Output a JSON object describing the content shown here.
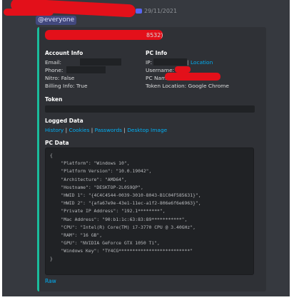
{
  "message": {
    "timestamp": "29/11/2021",
    "mention": "@everyone",
    "author_suffix": "8532)"
  },
  "embed": {
    "account_info_title": "Account Info",
    "pc_info_title": "PC Info",
    "account": {
      "email_label": "Email:",
      "phone_label": "Phone:",
      "nitro": "Nitro: False",
      "billing": "Billing Info: True"
    },
    "pc": {
      "ip_label": "IP:",
      "location_link": "Location",
      "username_label": "Username:",
      "pc_name_label": "PC Nam",
      "token_location": "Token Location: Google Chrome"
    },
    "token_title": "Token",
    "logged_data_title": "Logged Data",
    "logged_links": [
      "History",
      "Cookies",
      "Passwords",
      "Desktop Image"
    ],
    "pc_data_title": "PC Data",
    "code_lines": [
      "{",
      "    \"Platform\": \"Windows 10\",",
      "    \"Platform Version\": \"10.0.19042\",",
      "    \"Architecture\": \"AMD64\",",
      "    \"Hostname\": \"DESKTOP-2L0S9QP\",",
      "    \"HWID 1\": \"{4C4C4544-0039-3010-8043-B1C04F585631}\",",
      "    \"HWID 2\": \"{afa67e9e-43e1-11ec-a1f2-806e6f6e6963}\",",
      "    \"Private IP Address\": \"192.1********\",",
      "    \"Mac Address\": \"90:b1:1c:63:83:89***********\",",
      "    \"CPU\": \"Intel(R) Core(TM) i7-3770 CPU @ 3.40GHz\",",
      "    \"RAM\": \"16 GB\",",
      "    \"GPU\": \"NVIDIA GeForce GTX 1050 Ti\",",
      "    \"Windows Key\": \"TY4CG**************************\"",
      "}"
    ],
    "raw_link": "Raw"
  },
  "colors": {
    "background": "#36393f",
    "embed_bg": "#2f3136",
    "embed_accent": "#1abc9c",
    "link": "#00aff4",
    "redaction": "#e3101a"
  }
}
